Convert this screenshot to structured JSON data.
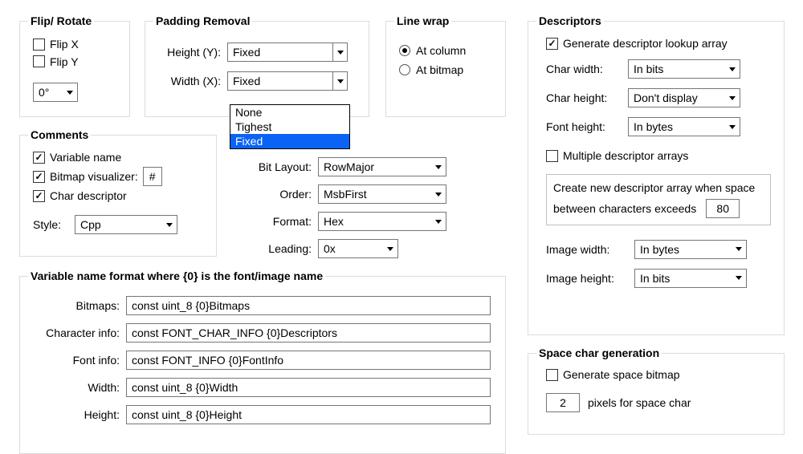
{
  "flip_rotate": {
    "legend": "Flip/ Rotate",
    "flip_x": "Flip X",
    "flip_y": "Flip Y",
    "deg": "0°"
  },
  "padding_removal": {
    "legend": "Padding Removal",
    "height_label": "Height (Y):",
    "height_value": "Fixed",
    "width_label": "Width (X):",
    "width_value": "Fixed",
    "dropdown": {
      "opt0": "None",
      "opt1": "Tighest",
      "opt2": "Fixed"
    }
  },
  "line_wrap": {
    "legend": "Line wrap",
    "at_column": "At column",
    "at_bitmap": "At bitmap"
  },
  "comments": {
    "legend": "Comments",
    "variable_name": "Variable name",
    "bitmap_visualizer": "Bitmap visualizer:",
    "bitmap_visualizer_char": "#",
    "char_descriptor": "Char descriptor",
    "style_label": "Style:",
    "style_value": "Cpp"
  },
  "byte": {
    "bit_layout_label": "Bit Layout:",
    "bit_layout_value": "RowMajor",
    "order_label": "Order:",
    "order_value": "MsbFirst",
    "format_label": "Format:",
    "format_value": "Hex",
    "leading_label": "Leading:",
    "leading_value": "0x"
  },
  "varfmt": {
    "heading": "Variable name format where {0} is the font/image name",
    "bitmaps_label": "Bitmaps:",
    "bitmaps_value": "const uint_8 {0}Bitmaps",
    "charinfo_label": "Character info:",
    "charinfo_value": "const FONT_CHAR_INFO {0}Descriptors",
    "fontinfo_label": "Font info:",
    "fontinfo_value": "const FONT_INFO {0}FontInfo",
    "width_label": "Width:",
    "width_value": "const uint_8 {0}Width",
    "height_label": "Height:",
    "height_value": "const uint_8 {0}Height"
  },
  "descriptors": {
    "legend": "Descriptors",
    "generate_lookup": "Generate descriptor lookup array",
    "char_width_label": "Char width:",
    "char_width_value": "In bits",
    "char_height_label": "Char height:",
    "char_height_value": "Don't display",
    "font_height_label": "Font height:",
    "font_height_value": "In bytes",
    "multiple_arrays": "Multiple descriptor arrays",
    "create_new_text1": "Create new descriptor array when space",
    "create_new_text2": "between characters exceeds",
    "threshold": "80",
    "image_width_label": "Image width:",
    "image_width_value": "In bytes",
    "image_height_label": "Image height:",
    "image_height_value": "In bits"
  },
  "space_gen": {
    "legend": "Space char generation",
    "generate_space_bitmap": "Generate space bitmap",
    "pixels_value": "2",
    "pixels_label": "pixels for space char"
  }
}
